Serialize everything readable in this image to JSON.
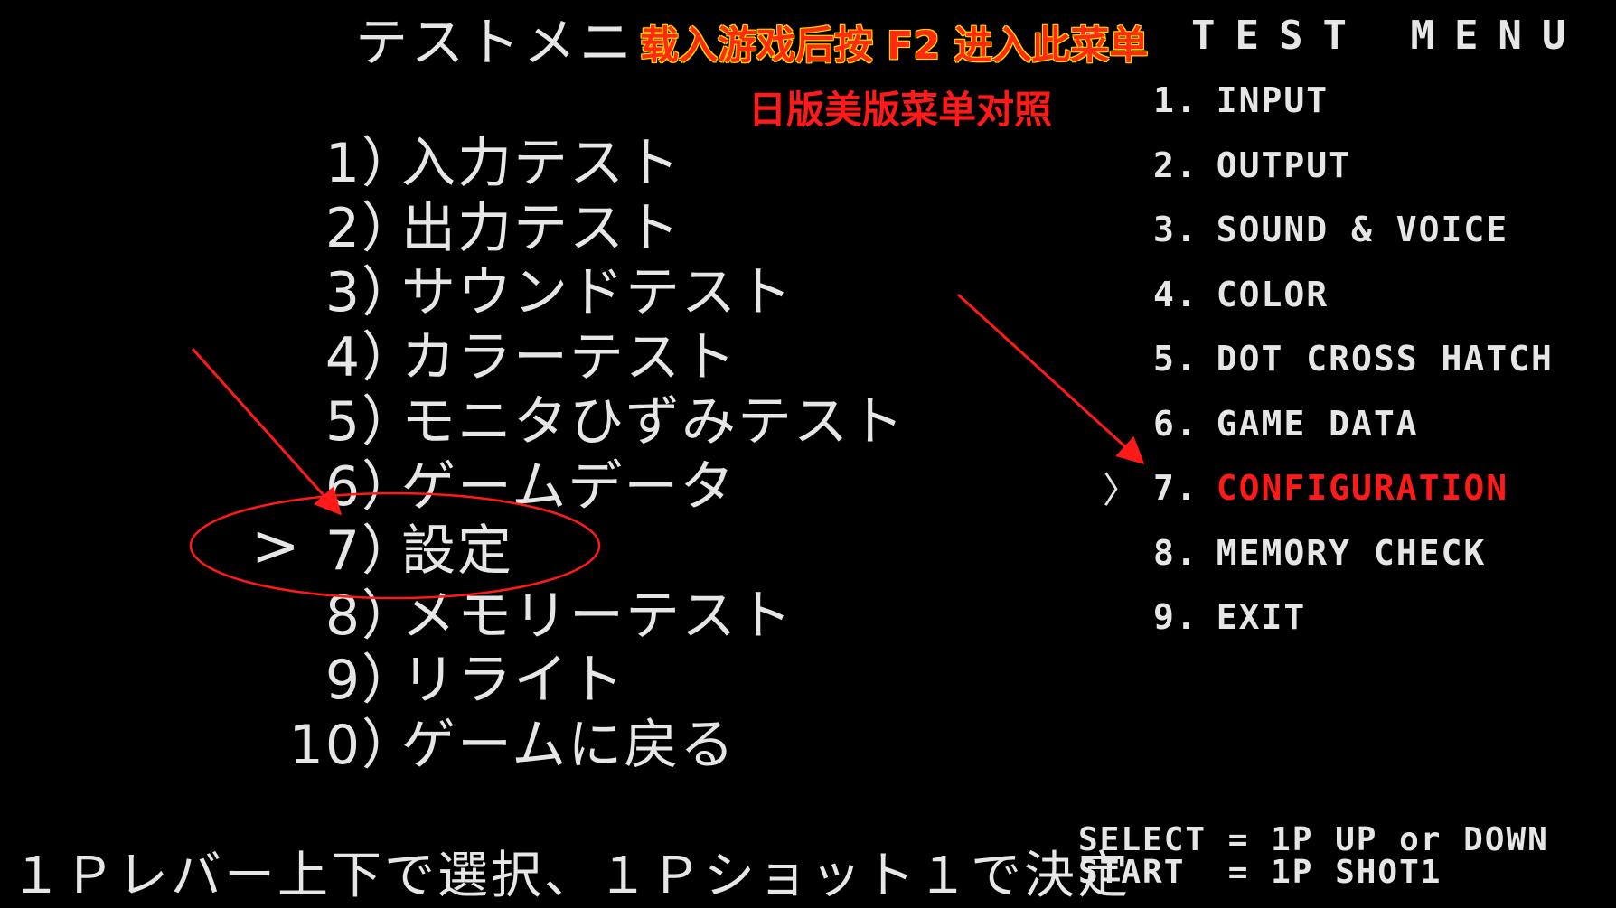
{
  "jp_menu": {
    "title": "テストメニュー",
    "items": [
      {
        "num": "1",
        "label": "入力テスト"
      },
      {
        "num": "2",
        "label": "出力テスト"
      },
      {
        "num": "3",
        "label": "サウンドテスト"
      },
      {
        "num": "4",
        "label": "カラーテスト"
      },
      {
        "num": "5",
        "label": "モニタひずみテスト"
      },
      {
        "num": "6",
        "label": "ゲームデータ"
      },
      {
        "num": "7",
        "label": "設定"
      },
      {
        "num": "8",
        "label": "メモリーテスト"
      },
      {
        "num": "9",
        "label": "リライト"
      },
      {
        "num": "10",
        "label": "ゲームに戻る"
      }
    ],
    "paren": "）",
    "cursor": ">",
    "selected_index": 6
  },
  "en_menu": {
    "title": "TEST MENU",
    "items": [
      {
        "num": "1.",
        "label": "INPUT"
      },
      {
        "num": "2.",
        "label": "OUTPUT"
      },
      {
        "num": "3.",
        "label": "SOUND & VOICE"
      },
      {
        "num": "4.",
        "label": "COLOR"
      },
      {
        "num": "5.",
        "label": "DOT CROSS HATCH"
      },
      {
        "num": "6.",
        "label": "GAME DATA"
      },
      {
        "num": "7.",
        "label": "CONFIGURATION"
      },
      {
        "num": "8.",
        "label": "MEMORY CHECK"
      },
      {
        "num": "9.",
        "label": "EXIT"
      }
    ],
    "cursor": "〉",
    "selected_index": 6
  },
  "overlay": {
    "title": "载入游戏后按 F2 进入此菜单",
    "subtitle": "日版美版菜单对照"
  },
  "footer": {
    "jp_instructions": "１Ｐレバー上下で選択、１Ｐショット１で決定",
    "en_select": "SELECT = 1P UP or DOWN",
    "en_start": "START  = 1P SHOT1"
  },
  "colors": {
    "background": "#000000",
    "text": "#e6e6e6",
    "highlight": "#ff1a1a",
    "annotation": "#ff1a1a"
  }
}
